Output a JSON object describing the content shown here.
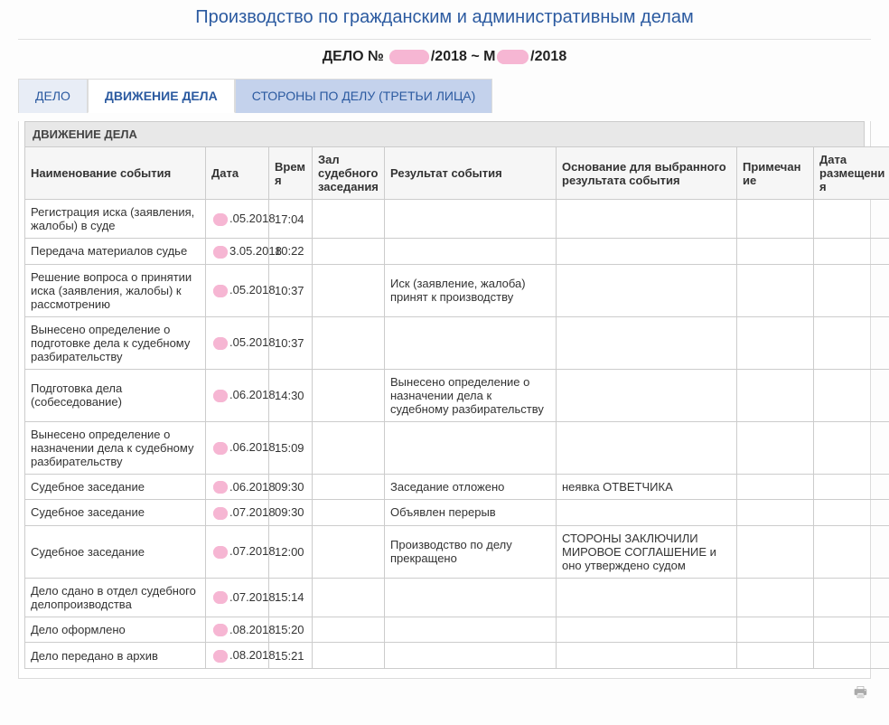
{
  "heading": "Производство по гражданским и административным делам",
  "case": {
    "prefix": "ДЕЛО №",
    "part1_suffix": "/2018",
    "separator": "~",
    "part2_suffix": "/2018"
  },
  "tabs": {
    "case": "ДЕЛО",
    "motion": "ДВИЖЕНИЕ ДЕЛА",
    "sides": "СТОРОНЫ ПО ДЕЛУ (ТРЕТЬИ ЛИЦА)"
  },
  "section_title": "ДВИЖЕНИЕ ДЕЛА",
  "columns": {
    "event": "Наименование события",
    "date": "Дата",
    "time": "Время",
    "room": "Зал судебного заседания",
    "result": "Результат события",
    "basis": "Основание для выбранного результата события",
    "note": "Примечание",
    "posted": "Дата размещения"
  },
  "rows": [
    {
      "event": "Регистрация иска (заявления, жалобы) в суде",
      "date_suffix": ".05.2018",
      "time": "17:04",
      "room": "",
      "result": "",
      "basis": "",
      "note": "",
      "posted": ""
    },
    {
      "event": "Передача материалов судье",
      "date_suffix": "3.05.2018",
      "time": "10:22",
      "room": "",
      "result": "",
      "basis": "",
      "note": "",
      "posted": ""
    },
    {
      "event": "Решение вопроса о принятии иска (заявления, жалобы) к рассмотрению",
      "date_suffix": ".05.2018",
      "time": "10:37",
      "room": "",
      "result": "Иск (заявление, жалоба) принят к производству",
      "basis": "",
      "note": "",
      "posted": ""
    },
    {
      "event": "Вынесено определение о подготовке дела к судебному разбирательству",
      "date_suffix": ".05.2018",
      "time": "10:37",
      "room": "",
      "result": "",
      "basis": "",
      "note": "",
      "posted": ""
    },
    {
      "event": "Подготовка дела (собеседование)",
      "date_suffix": ".06.2018",
      "time": "14:30",
      "room": "",
      "result": "Вынесено определение о назначении дела к судебному разбирательству",
      "basis": "",
      "note": "",
      "posted": ""
    },
    {
      "event": "Вынесено определение о назначении дела к судебному разбирательству",
      "date_suffix": ".06.2018",
      "time": "15:09",
      "room": "",
      "result": "",
      "basis": "",
      "note": "",
      "posted": ""
    },
    {
      "event": "Судебное заседание",
      "date_suffix": ".06.2018",
      "time": "09:30",
      "room": "",
      "result": "Заседание отложено",
      "basis": "неявка ОТВЕТЧИКА",
      "note": "",
      "posted": ""
    },
    {
      "event": "Судебное заседание",
      "date_suffix": ".07.2018",
      "time": "09:30",
      "room": "",
      "result": "Объявлен перерыв",
      "basis": "",
      "note": "",
      "posted": ""
    },
    {
      "event": "Судебное заседание",
      "date_suffix": ".07.2018",
      "time": "12:00",
      "room": "",
      "result": "Производство по делу прекращено",
      "basis": "СТОРОНЫ ЗАКЛЮЧИЛИ МИРОВОЕ СОГЛАШЕНИЕ и оно утверждено судом",
      "note": "",
      "posted": ""
    },
    {
      "event": "Дело сдано в отдел судебного делопроизводства",
      "date_suffix": ".07.2018",
      "time": "15:14",
      "room": "",
      "result": "",
      "basis": "",
      "note": "",
      "posted": ""
    },
    {
      "event": "Дело оформлено",
      "date_suffix": ".08.2018",
      "time": "15:20",
      "room": "",
      "result": "",
      "basis": "",
      "note": "",
      "posted": ""
    },
    {
      "event": "Дело передано в архив",
      "date_suffix": ".08.2018",
      "time": "15:21",
      "room": "",
      "result": "",
      "basis": "",
      "note": "",
      "posted": ""
    }
  ],
  "icons": {
    "print": "🖶"
  }
}
